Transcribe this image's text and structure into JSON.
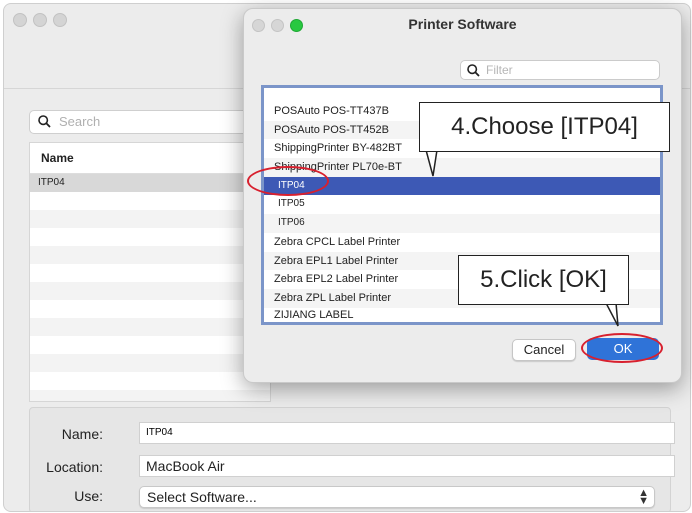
{
  "background_window": {
    "search_placeholder": "Search",
    "list_header": "Name",
    "rows": [
      "ITP04"
    ],
    "form": {
      "name_label": "Name:",
      "name_value": "ITP04",
      "location_label": "Location:",
      "location_value": "MacBook Air",
      "use_label": "Use:",
      "use_value": "Select Software..."
    }
  },
  "dialog": {
    "title": "Printer Software",
    "filter_placeholder": "Filter",
    "items": [
      "POSAuto POS-TT437B",
      "POSAuto POS-TT452B",
      "ShippingPrinter BY-482BT",
      "ShippingPrinter PL70e-BT",
      "ITP04",
      "ITP05",
      "ITP06",
      "Zebra CPCL Label Printer",
      "Zebra EPL1 Label Printer",
      "Zebra EPL2 Label Printer",
      "Zebra ZPL Label Printer",
      "ZIJIANG LABEL"
    ],
    "selected_item": "ITP04",
    "cancel_label": "Cancel",
    "ok_label": "OK"
  },
  "annotations": {
    "step4": "4.Choose [ITP04]",
    "step5": "5.Click [OK]"
  },
  "colors": {
    "selection": "#3d59b5",
    "ok_button": "#2f73d8",
    "highlight": "#d8202e",
    "traffic_close": "#ff5f57",
    "traffic_min": "#febc2e",
    "traffic_max": "#28c840"
  }
}
